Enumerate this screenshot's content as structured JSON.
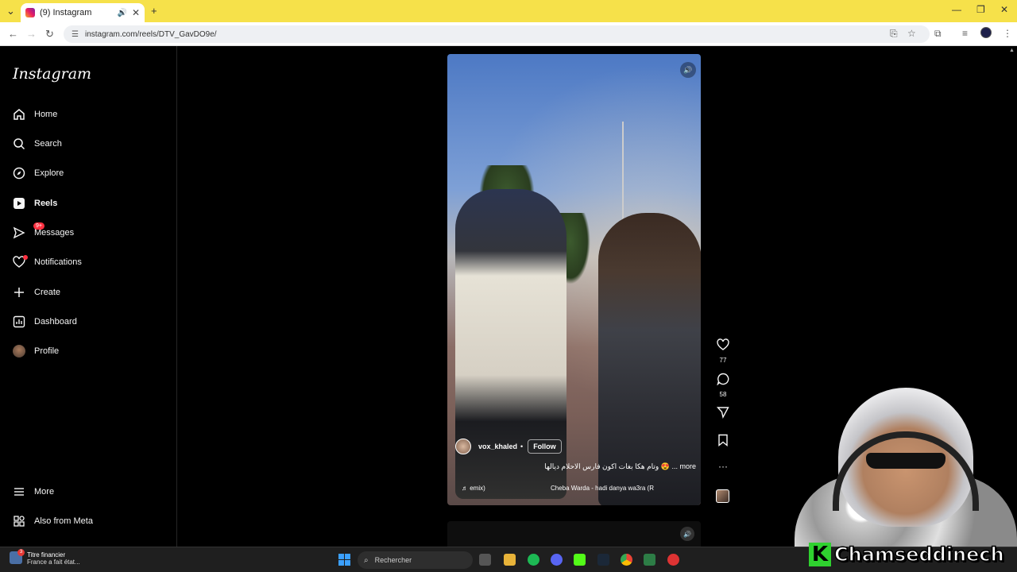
{
  "browser": {
    "tab_title": "(9) Instagram",
    "url": "instagram.com/reels/DTV_GavDO9e/",
    "back_icon": "←",
    "forward_icon": "→",
    "reload_icon": "↻",
    "new_tab_icon": "+",
    "close_tab_icon": "✕",
    "audio_icon": "🔊"
  },
  "sidebar": {
    "logo": "Instagram",
    "items": [
      {
        "label": "Home",
        "icon": "home-icon"
      },
      {
        "label": "Search",
        "icon": "search-icon"
      },
      {
        "label": "Explore",
        "icon": "compass-icon"
      },
      {
        "label": "Reels",
        "icon": "reels-icon"
      },
      {
        "label": "Messages",
        "icon": "messenger-icon",
        "badge": "9+"
      },
      {
        "label": "Notifications",
        "icon": "heart-icon"
      },
      {
        "label": "Create",
        "icon": "plus-icon"
      },
      {
        "label": "Dashboard",
        "icon": "dashboard-icon"
      },
      {
        "label": "Profile",
        "icon": "avatar"
      }
    ],
    "more": "More",
    "also_from_meta": "Also from Meta"
  },
  "reel": {
    "username": "vox_khaled",
    "separator": "•",
    "follow_label": "Follow",
    "caption": "وتام هكا بغات اكون فارس الاحلام ديالها 😍 ... more",
    "music_left": "♬ emix)",
    "music_right": "Cheba Warda - hadi danya wa3ra (R",
    "likes": "77",
    "comments": "58"
  },
  "streamer": {
    "initial": "K",
    "name": "Chamseddinech"
  },
  "taskbar": {
    "news_badge": "3",
    "news_title": "Titre financier",
    "news_sub": "France a fait état...",
    "search_placeholder": "Rechercher"
  },
  "colors": {
    "titlebar": "#f6e14a",
    "notification_red": "#ff3040",
    "streamer_green": "#2fd12f"
  }
}
